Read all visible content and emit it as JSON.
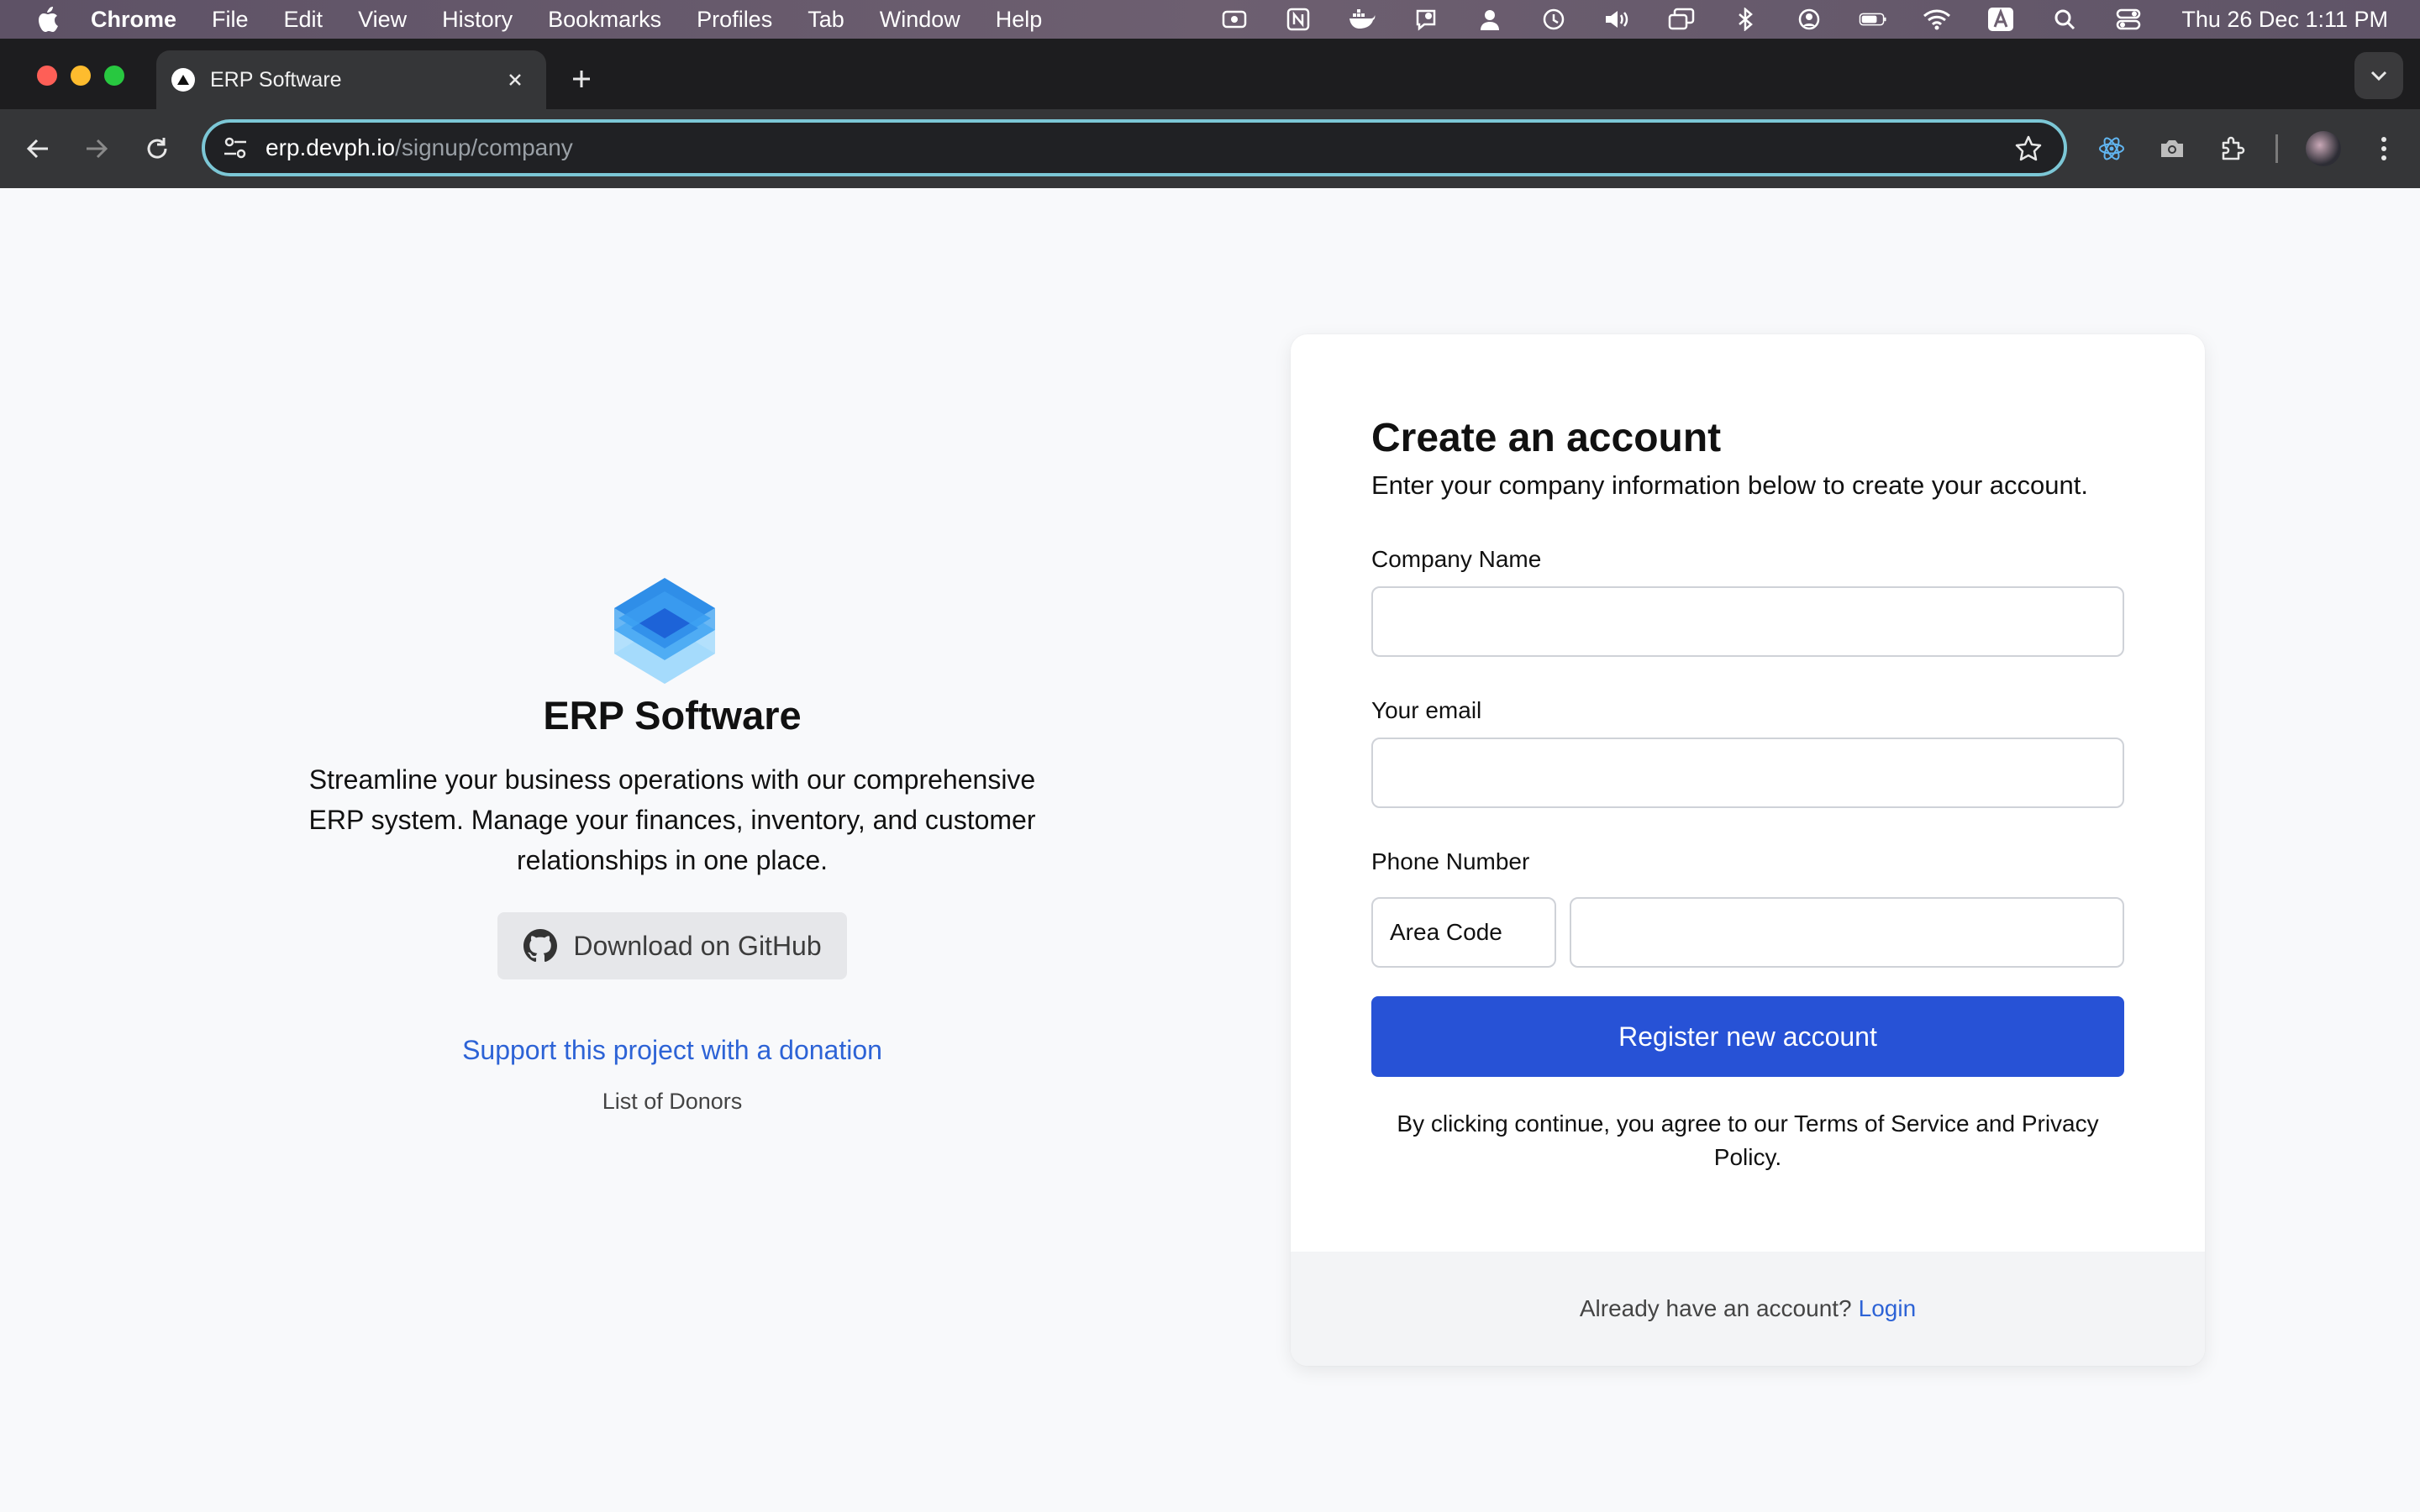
{
  "menubar": {
    "app_name": "Chrome",
    "items": [
      "File",
      "Edit",
      "View",
      "History",
      "Bookmarks",
      "Profiles",
      "Tab",
      "Window",
      "Help"
    ],
    "clock": "Thu 26 Dec  1:11 PM"
  },
  "browser": {
    "tab_title": "ERP Software",
    "url_host": "erp.devph.io",
    "url_path": "/signup/company"
  },
  "hero": {
    "title": "ERP Software",
    "description": "Streamline your business operations with our comprehensive ERP system. Manage your finances, inventory, and customer relationships in one place.",
    "github_button": "Download on GitHub",
    "donation_link": "Support this project with a donation",
    "donors_link": "List of Donors"
  },
  "form": {
    "heading": "Create an account",
    "subheading": "Enter your company information below to create your account.",
    "company_label": "Company Name",
    "company_value": "",
    "email_label": "Your email",
    "email_value": "",
    "phone_label": "Phone Number",
    "area_code": "Area Code",
    "phone_value": "",
    "register_button": "Register new account",
    "terms_text": "By clicking continue, you agree to our Terms of Service and Privacy Policy.",
    "footer_text": "Already have an account?",
    "login_link": "Login"
  },
  "colors": {
    "primary": "#2752d6",
    "link": "#2d63d6",
    "omnibox_focus": "#7cc7d6"
  }
}
